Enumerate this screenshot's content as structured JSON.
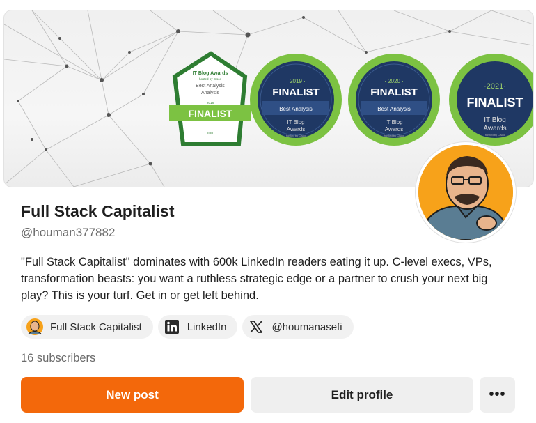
{
  "banner": {
    "badge_2018": {
      "header": "IT Blog Awards",
      "sub": "hosted by Cisco",
      "category": "Best Analysis",
      "year": "2018",
      "ribbon": "FINALIST"
    },
    "badges": [
      {
        "year": "· 2019 ·",
        "status": "FINALIST",
        "category": "Best Analysis",
        "line1": "IT Blog",
        "line2": "Awards",
        "host": "hosted by Cisco"
      },
      {
        "year": "· 2020 ·",
        "status": "FINALIST",
        "category": "Best Analysis",
        "line1": "IT Blog",
        "line2": "Awards",
        "host": "hosted by Cisco"
      },
      {
        "year": "·2021·",
        "status": "FINALIST",
        "line1": "IT Blog",
        "line2": "Awards",
        "host": "hosted by Cisco"
      }
    ]
  },
  "profile": {
    "name": "Full Stack Capitalist",
    "handle": "@houman377882",
    "bio": "\"Full Stack Capitalist\" dominates with 600k LinkedIn readers eating it up. C-level execs, VPs, transformation beasts: you want a ruthless strategic edge or a partner to crush your next big play? This is your turf. Get in or get left behind.",
    "subscribers": "16 subscribers"
  },
  "links": [
    {
      "label": "Full Stack Capitalist",
      "icon": "avatar-icon"
    },
    {
      "label": "LinkedIn",
      "icon": "linkedin-icon"
    },
    {
      "label": "@houmanasefi",
      "icon": "x-logo-icon"
    }
  ],
  "actions": {
    "new_post": "New post",
    "edit_profile": "Edit profile",
    "more": "•••"
  },
  "colors": {
    "accent": "#f3680b",
    "badge_green": "#7cc242",
    "badge_navy": "#1f3864",
    "avatar_bg": "#f7a21a"
  }
}
